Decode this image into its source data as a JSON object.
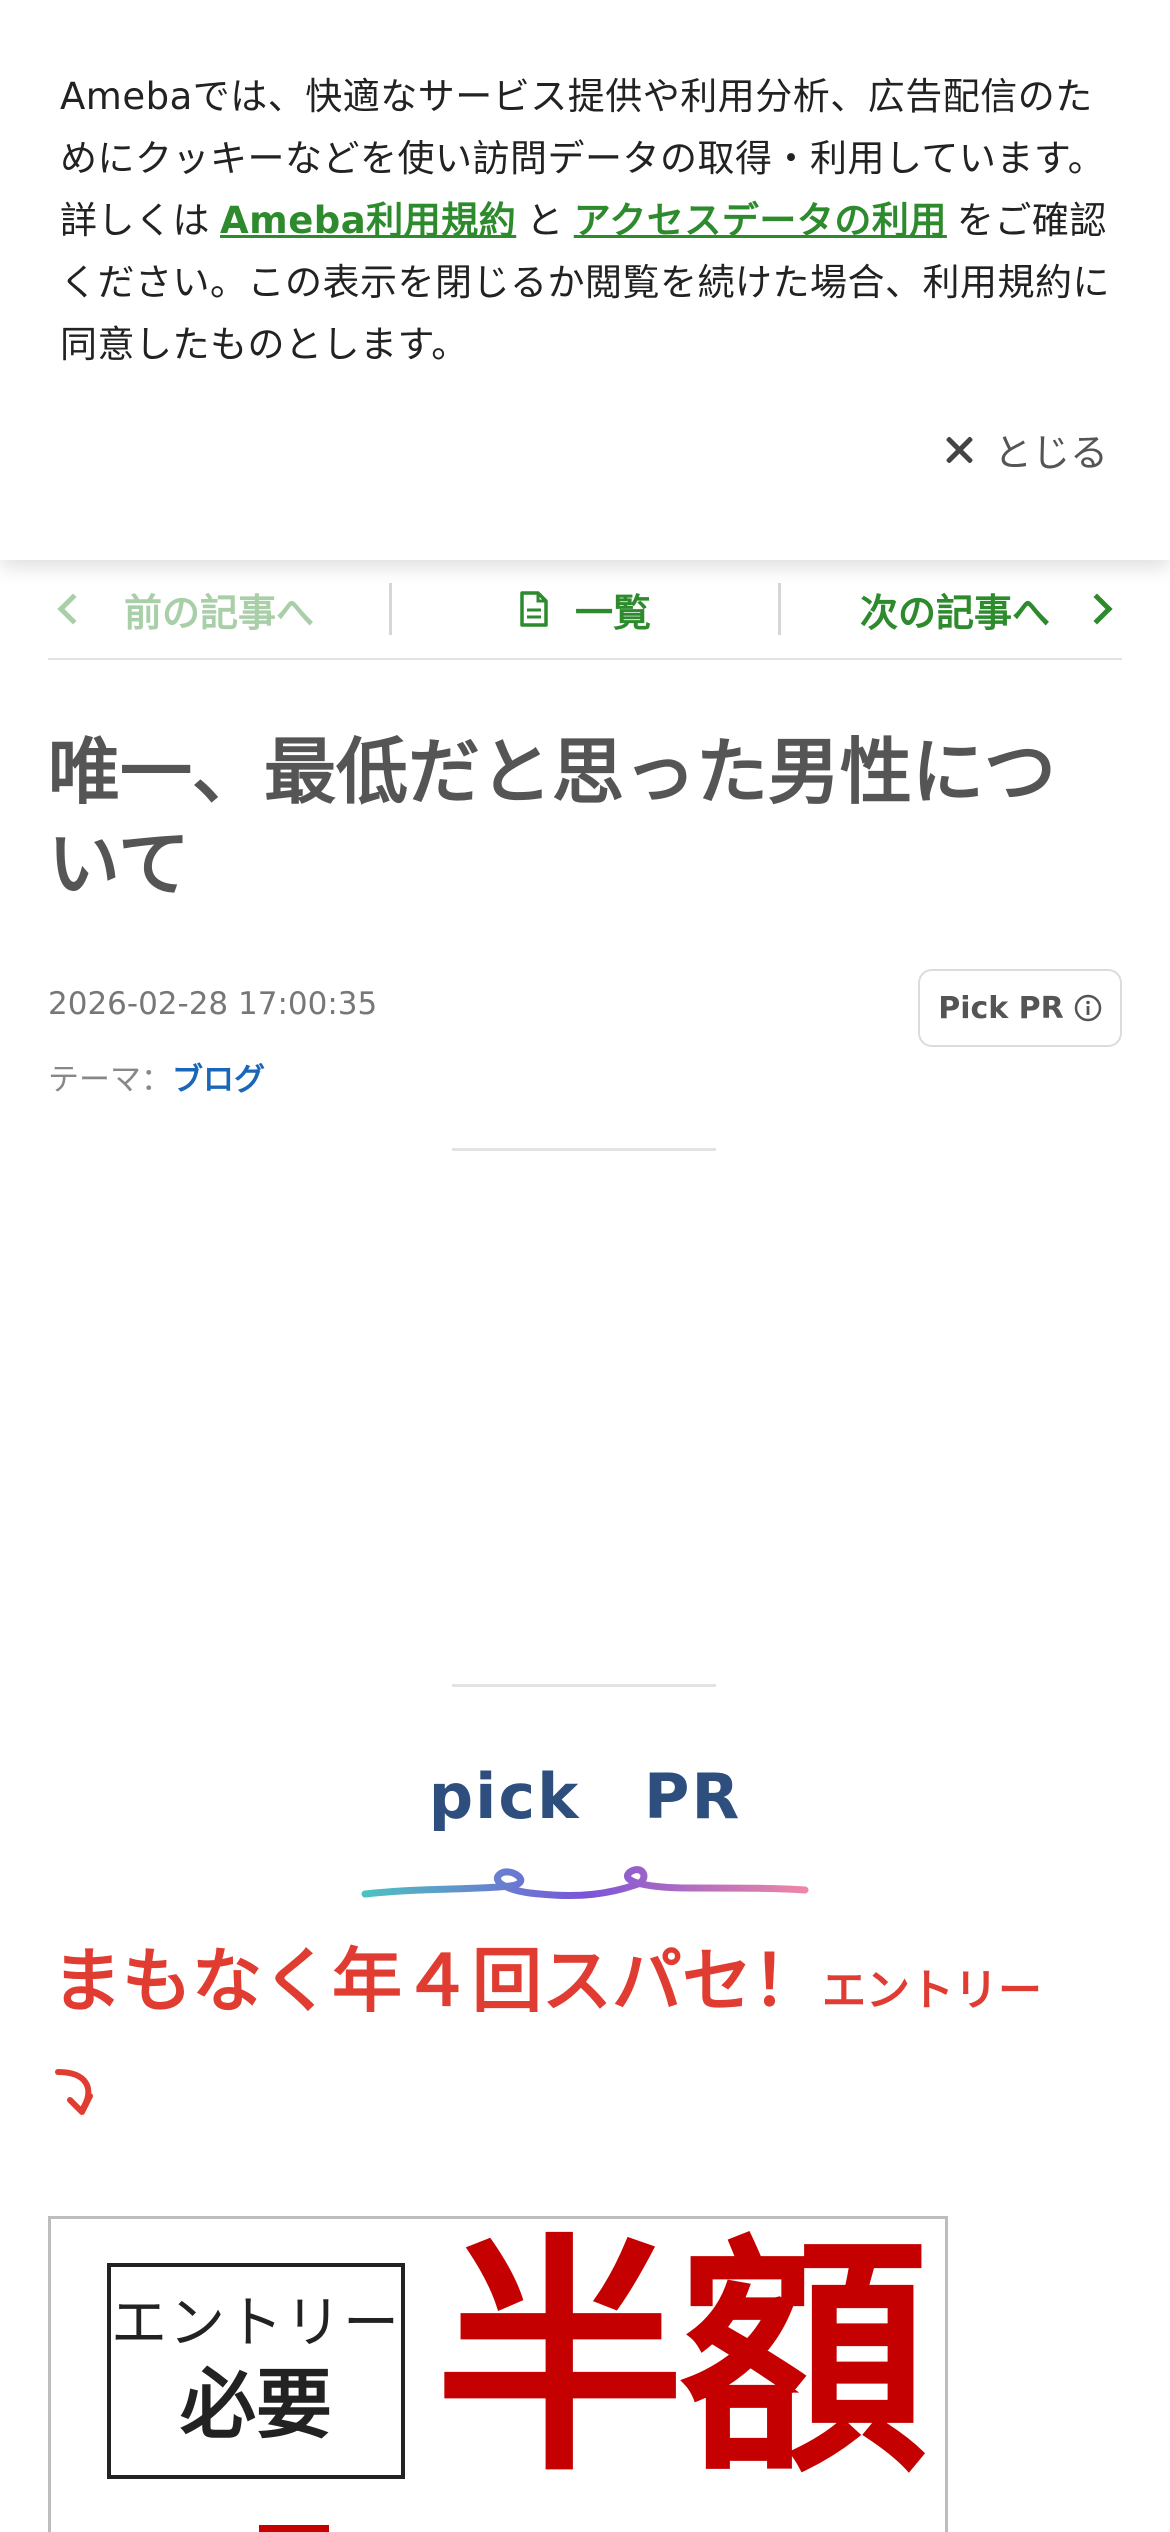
{
  "cookie": {
    "text_before": "Amebaでは、快適なサービス提供や利用分析、広告配信のためにクッキーなどを使い訪問データの取得・利用しています。詳しくは",
    "link1": "Ameba利用規約",
    "connector": "と",
    "link2": "アクセスデータの利用",
    "text_after": "をご確認ください。この表示を閉じるか閲覧を続けた場合、利用規約に同意したものとします。",
    "close_label": "とじる"
  },
  "nav": {
    "prev_label": "前の記事へ",
    "list_label": "一覧",
    "next_label": "次の記事へ"
  },
  "article": {
    "title": "唯一、最低だと思った男性について",
    "date": "2026-02-28 17:00:35",
    "theme_label": "テーマ：",
    "theme_value": "ブログ",
    "pickpr_badge": "Pick PR"
  },
  "pick": {
    "heading": "pick PR",
    "promo_big": "まもなく年４回スパセ！",
    "promo_small": "エントリー"
  },
  "banner": {
    "entry_top": "エントリー",
    "entry_bottom": "必要",
    "half": "半額"
  },
  "colors": {
    "green": "#2d8a2d",
    "light_green": "#a9cfa9",
    "promo_red": "#e03c31",
    "banner_red": "#c40000",
    "link_blue": "#1a66b8",
    "pick_navy": "#2e4f7e"
  }
}
